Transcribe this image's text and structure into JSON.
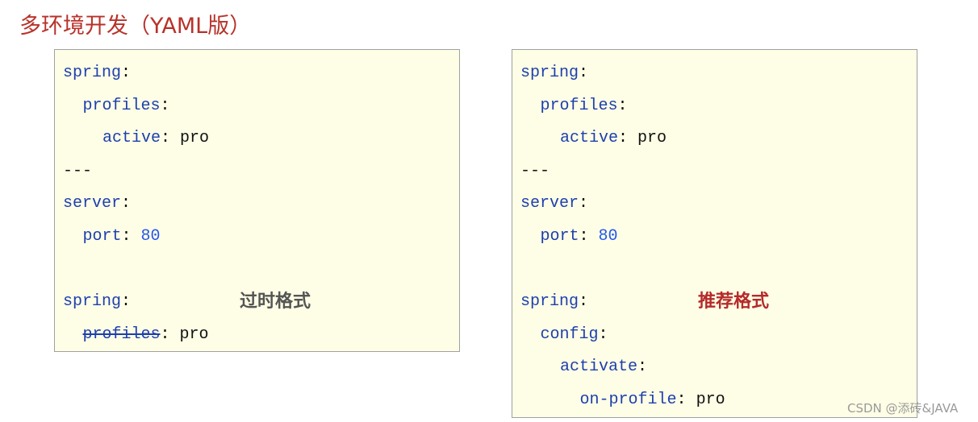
{
  "title": "多环境开发（YAML版）",
  "panels": [
    {
      "tag": "过时格式",
      "tag_color": "#555555",
      "lines": [
        {
          "indent": 0,
          "key": "spring",
          "value": ""
        },
        {
          "indent": 1,
          "key": "profiles",
          "value": ""
        },
        {
          "indent": 2,
          "key": "active",
          "value": "pro"
        },
        {
          "indent": 0,
          "text": "---"
        },
        {
          "indent": 0,
          "key": "server",
          "value": ""
        },
        {
          "indent": 1,
          "key": "port",
          "value": "80",
          "numeric": true
        },
        {
          "indent": 0,
          "text": ""
        },
        {
          "indent": 0,
          "key": "spring",
          "value": ""
        },
        {
          "indent": 1,
          "key": "profiles",
          "value": "pro",
          "deprecated": true
        }
      ]
    },
    {
      "tag": "推荐格式",
      "tag_color": "#b52a2a",
      "lines": [
        {
          "indent": 0,
          "key": "spring",
          "value": ""
        },
        {
          "indent": 1,
          "key": "profiles",
          "value": ""
        },
        {
          "indent": 2,
          "key": "active",
          "value": "pro"
        },
        {
          "indent": 0,
          "text": "---"
        },
        {
          "indent": 0,
          "key": "server",
          "value": ""
        },
        {
          "indent": 1,
          "key": "port",
          "value": "80",
          "numeric": true
        },
        {
          "indent": 0,
          "text": ""
        },
        {
          "indent": 0,
          "key": "spring",
          "value": ""
        },
        {
          "indent": 1,
          "key": "config",
          "value": ""
        },
        {
          "indent": 2,
          "key": "activate",
          "value": ""
        },
        {
          "indent": 3,
          "key": "on-profile",
          "value": "pro"
        }
      ]
    }
  ],
  "watermark": "CSDN @添砖&JAVA"
}
